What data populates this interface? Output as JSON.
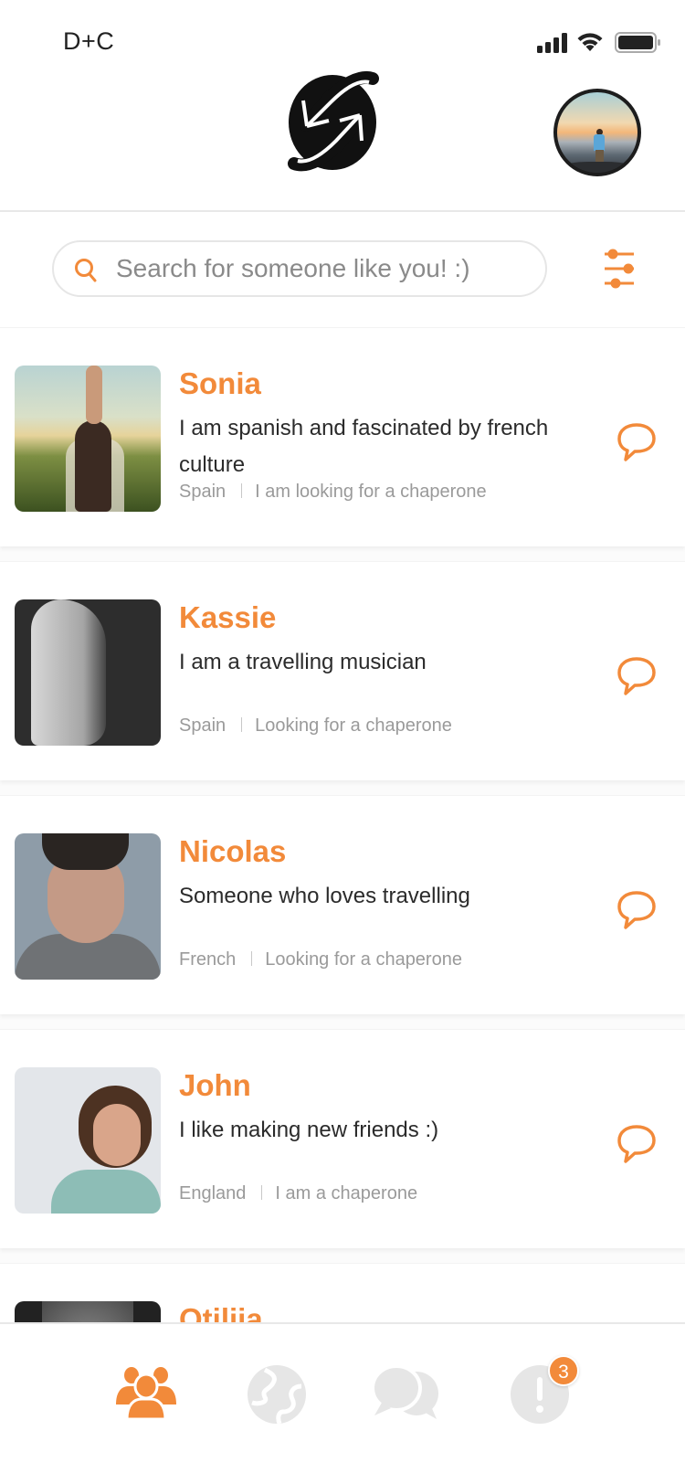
{
  "status_bar": {
    "carrier": "D+C",
    "signal_icon": "cellular-signal-icon",
    "wifi_icon": "wifi-icon",
    "battery_icon": "battery-full-icon"
  },
  "header": {
    "logo_icon": "orbit-arrows-logo-icon",
    "profile_avatar_alt": "User profile photo - person on mountain at sunrise"
  },
  "search": {
    "placeholder": "Search for someone like you! :)",
    "value": "",
    "search_icon": "search-icon",
    "filter_icon": "sliders-filter-icon"
  },
  "theme": {
    "accent": "#F28A3A",
    "text_primary": "#2B2B2B",
    "text_muted": "#9A9A9A",
    "icon_inactive": "#E6E6E6"
  },
  "people": [
    {
      "name": "Sonia",
      "bio": "I am spanish and fascinated by french culture",
      "country": "Spain",
      "status": "I am looking for a chaperone",
      "photo": "woman-in-sunflower-field"
    },
    {
      "name": "Kassie",
      "bio": "I am a travelling musician",
      "country": "Spain",
      "status": "Looking for a chaperone",
      "photo": "woman-profile-black-and-white"
    },
    {
      "name": "Nicolas",
      "bio": "Someone who loves travelling",
      "country": "French",
      "status": "Looking for a chaperone",
      "photo": "man-portrait-grey-sweater"
    },
    {
      "name": "John",
      "bio": "I like making new friends :)",
      "country": "England",
      "status": "I am a chaperone",
      "photo": "man-curly-hair-glasses"
    },
    {
      "name": "Otilija",
      "bio": "",
      "country": "",
      "status": "",
      "photo": "woman-close-up-black-and-white"
    }
  ],
  "bottom_nav": {
    "items": [
      {
        "id": "people",
        "icon": "people-group-icon",
        "active": true
      },
      {
        "id": "explore",
        "icon": "globe-icon",
        "active": false
      },
      {
        "id": "messages",
        "icon": "chat-bubbles-icon",
        "active": false
      },
      {
        "id": "notifications",
        "icon": "alert-icon",
        "active": false,
        "badge": "3"
      }
    ]
  }
}
